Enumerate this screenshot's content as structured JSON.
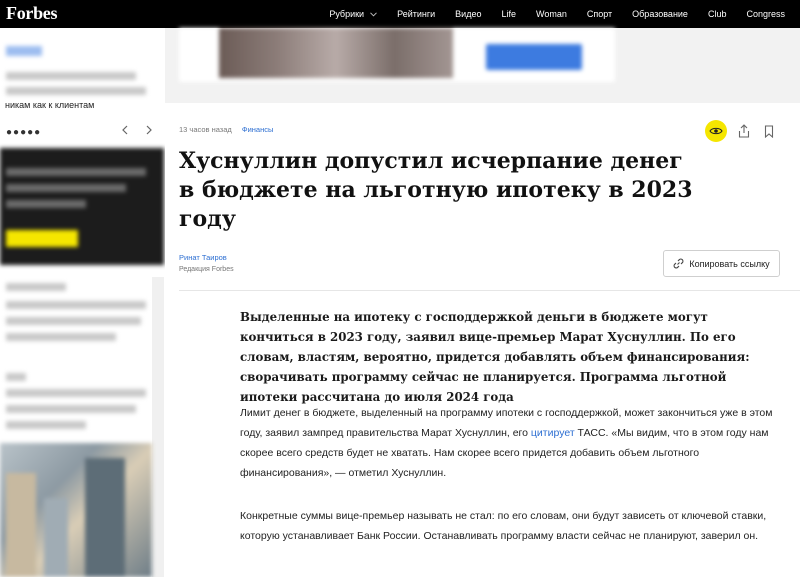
{
  "header": {
    "logo": "Forbes",
    "nav": [
      {
        "label": "Рубрики",
        "has_caret": true
      },
      {
        "label": "Рейтинги"
      },
      {
        "label": "Видео"
      },
      {
        "label": "Life"
      },
      {
        "label": "Woman"
      },
      {
        "label": "Спорт"
      },
      {
        "label": "Образование"
      },
      {
        "label": "Club"
      },
      {
        "label": "Congress"
      }
    ],
    "caret_icon": "chevron-down-icon"
  },
  "sidebar": {
    "visible_text": "никам как к клиентам",
    "carousel_dots": "●●●●●",
    "prev_icon": "chevron-left-icon",
    "next_icon": "chevron-right-icon"
  },
  "article": {
    "time": "13 часов назад",
    "category": "Финансы",
    "title": "Хуснуллин допустил исчерпание денег в бюджете на льготную ипотеку в 2023 году",
    "author": "Ринат Таиров",
    "author_sub": "Редакция Forbes",
    "copy_link_label": "Копировать ссылку",
    "lead": "Выделенные на ипотеку с господдержкой деньги в бюджете могут кончиться в 2023 году, заявил вице-премьер Марат Хуснуллин. По его словам, властям, вероятно, придется добавлять объем финансирования: сворачивать программу сейчас не планируется. Программа льготной ипотеки рассчитана до июля 2024 года",
    "p1_before": "Лимит денег в бюджете, выделенный на программу ипотеки с господдержкой, может закончиться уже в этом году, заявил зампред правительства Марат Хуснуллин, его ",
    "p1_link": "цитирует",
    "p1_after": " ТАСС. «Мы видим, что в этом году нам скорее всего средств будет не хватать. Нам скорее всего придется добавить объем льготного финансирования», — отметил Хуснуллин.",
    "p2": "Конкретные суммы вице-премьер называть не стал: по его словам, они будут зависеть от ключевой ставки, которую устанавливает Банк России. Останавливать программу власти сейчас не планируют, заверил он.",
    "icons": {
      "eye": "eye-icon",
      "share": "share-icon",
      "bookmark": "bookmark-icon",
      "link": "link-icon"
    }
  },
  "colors": {
    "accent_yellow": "#f5e600",
    "link_blue": "#2d6fd2",
    "topbar": "#000000"
  }
}
